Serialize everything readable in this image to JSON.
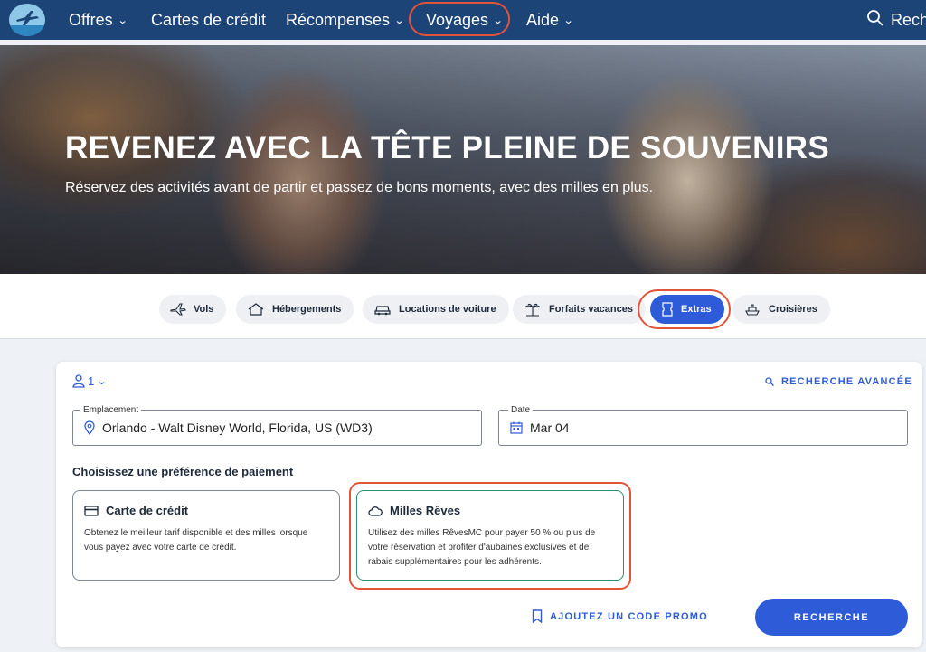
{
  "nav": {
    "items": [
      {
        "label": "Offres",
        "dropdown": true
      },
      {
        "label": "Cartes de crédit",
        "dropdown": false
      },
      {
        "label": "Récompenses",
        "dropdown": true
      },
      {
        "label": "Voyages",
        "dropdown": true
      },
      {
        "label": "Aide",
        "dropdown": true
      }
    ],
    "search_label": "Rech",
    "logo_icon": "airplane-logo-icon"
  },
  "hero": {
    "title": "REVENEZ AVEC LA TÊTE PLEINE DE SOUVENIRS",
    "subtitle": "Réservez des activités avant de partir et passez de bons moments, avec des milles en plus."
  },
  "tabs": [
    {
      "label": "Vols",
      "icon": "plane-icon"
    },
    {
      "label": "Hébergements",
      "icon": "house-icon"
    },
    {
      "label": "Locations de voiture",
      "icon": "car-icon"
    },
    {
      "label": "Forfaits vacances",
      "icon": "palm-tree-icon"
    },
    {
      "label": "Extras",
      "icon": "ticket-icon",
      "active": true
    },
    {
      "label": "Croisières",
      "icon": "ship-icon"
    }
  ],
  "search": {
    "travelers": "1",
    "advanced_label": "RECHERCHE AVANCÉE",
    "location": {
      "label": "Emplacement",
      "value": "Orlando - Walt Disney World, Florida, US (WD3)"
    },
    "date": {
      "label": "Date",
      "value": "Mar 04"
    },
    "pref_title": "Choisissez une préférence de paiement",
    "options": [
      {
        "title": "Carte de crédit",
        "desc": "Obtenez le meilleur tarif disponible et des milles lorsque vous payez avec votre carte de crédit.",
        "icon": "credit-card-icon"
      },
      {
        "title": "Milles Rêves",
        "desc": "Utilisez des milles RêvesMC pour payer 50 % ou plus de votre réservation et profiter d'aubaines exclusives et de rabais supplémentaires pour les adhérents.",
        "icon": "cloud-icon",
        "selected": true
      }
    ],
    "promo_label": "AJOUTEZ UN CODE PROMO",
    "submit_label": "RECHERCHE"
  },
  "colors": {
    "nav": "#1d4477",
    "accent": "#2e5bd8",
    "highlight": "#e0553a",
    "selected_border": "#2f8f6e"
  }
}
